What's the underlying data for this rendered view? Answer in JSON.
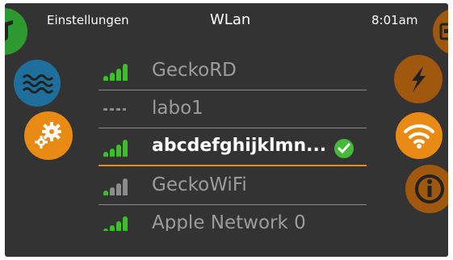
{
  "header": {
    "left_label": "Einstellungen",
    "title": "WLan",
    "time": "8:01am"
  },
  "colors": {
    "panel_bg": "#333333",
    "accent_orange": "#e98a14",
    "dim_orange": "#a0580f",
    "water_blue": "#1f6f9c",
    "signal_green": "#3cbf2a",
    "signal_gray": "#8c8c8c",
    "check_green": "#46b83a"
  },
  "left_icons": [
    {
      "name": "music-icon",
      "color": "#2c9a2e"
    },
    {
      "name": "water-waves-icon",
      "color": "#1f6f9c"
    },
    {
      "name": "settings-gears-icon",
      "color": "#e98a14"
    }
  ],
  "right_icons": [
    {
      "name": "stack-icon",
      "color": "#a0580f"
    },
    {
      "name": "lightning-icon",
      "color": "#a0580f"
    },
    {
      "name": "wifi-icon",
      "color": "#e98a14"
    },
    {
      "name": "info-icon",
      "color": "#a0580f"
    }
  ],
  "networks": [
    {
      "name": "GeckoRD",
      "signal": [
        1,
        1,
        1,
        1
      ],
      "connected": false
    },
    {
      "name": "labo1",
      "signal": "none",
      "connected": false
    },
    {
      "name": "abcdefghijklmn...",
      "signal": [
        1,
        1,
        1,
        1
      ],
      "connected": true
    },
    {
      "name": "GeckoWiFi",
      "signal": [
        1,
        0,
        0,
        0
      ],
      "connected": false
    },
    {
      "name": "Apple Network 0",
      "signal": [
        1,
        1,
        1,
        1
      ],
      "connected": false
    }
  ]
}
